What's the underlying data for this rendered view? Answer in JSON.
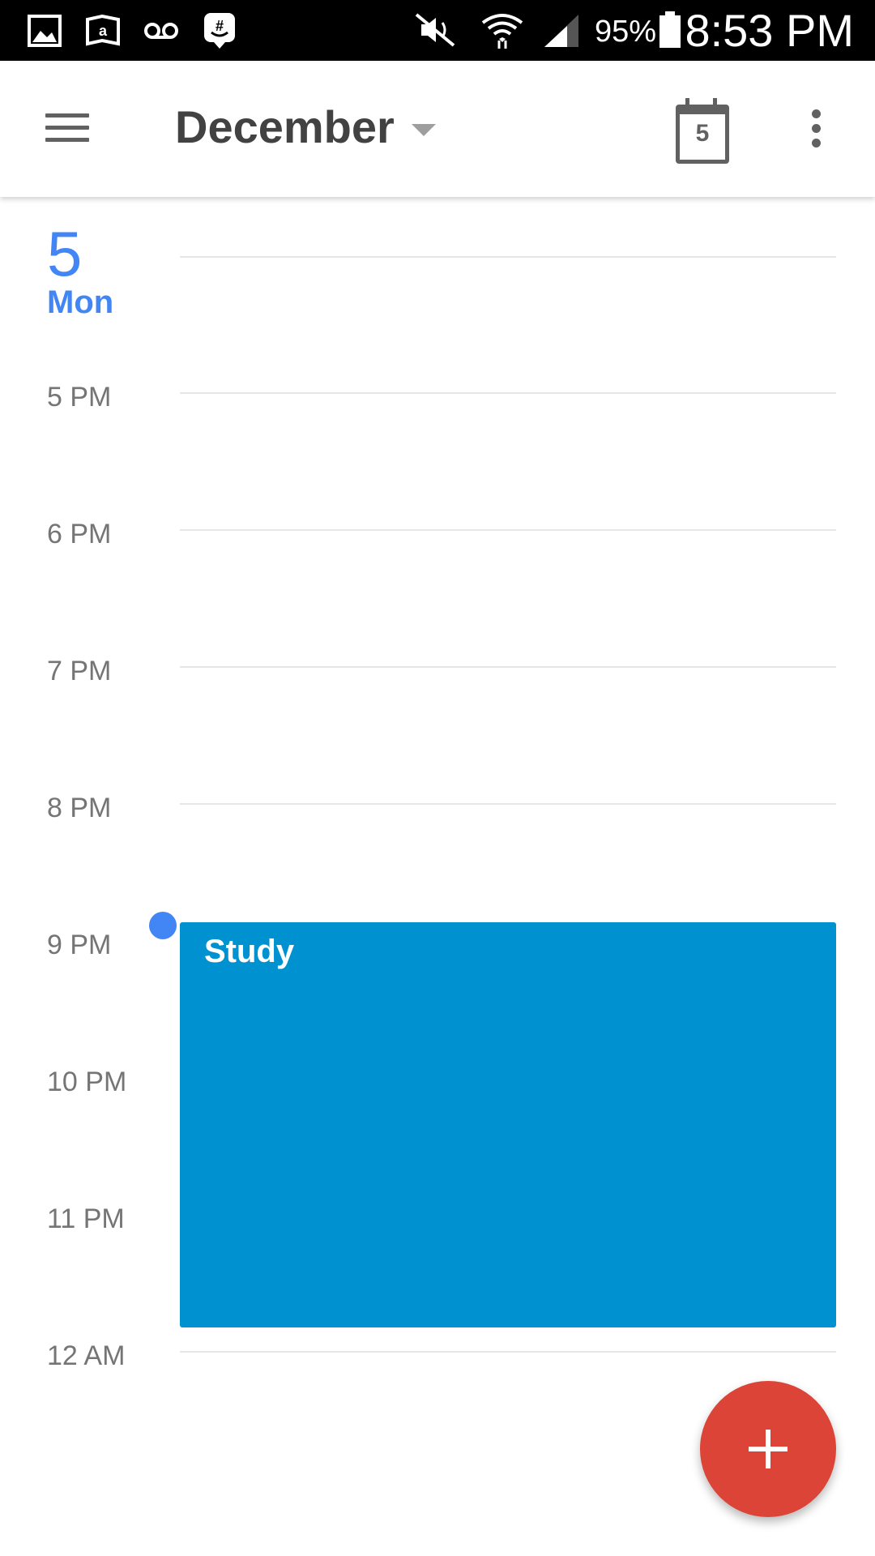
{
  "status_bar": {
    "battery_percent": "95%",
    "time": "8:53 PM",
    "icons": [
      "gallery-icon",
      "amazon-kindle-icon",
      "voicemail-icon",
      "groupme-icon",
      "mute-icon",
      "wifi-icon",
      "signal-icon",
      "battery-icon"
    ]
  },
  "app_bar": {
    "month": "December",
    "today_number": "5"
  },
  "day": {
    "number": "5",
    "weekday": "Mon"
  },
  "hours": [
    "5 PM",
    "6 PM",
    "7 PM",
    "8 PM",
    "9 PM",
    "10 PM",
    "11 PM",
    "12 AM"
  ],
  "events": [
    {
      "title": "Study",
      "start": "9 PM",
      "end": "12 AM",
      "color": "#0091d0"
    }
  ],
  "current_time": "8:53 PM",
  "colors": {
    "accent": "#4285f4",
    "event": "#0091d0",
    "fab": "#db4437"
  }
}
